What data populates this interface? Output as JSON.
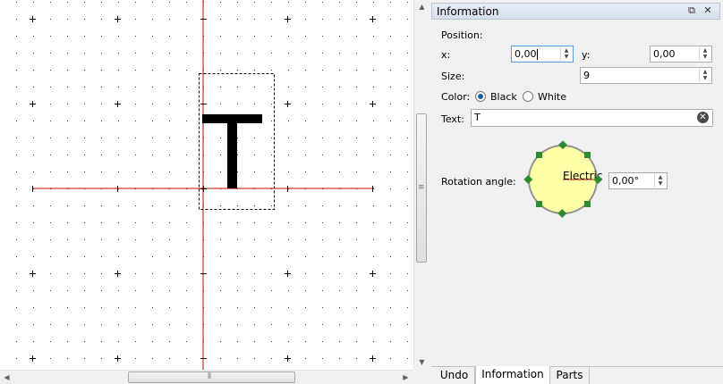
{
  "panel": {
    "title": "Information",
    "header_buttons": [
      "restore-icon",
      "close-icon"
    ]
  },
  "properties": {
    "position_label": "Position:",
    "x_label": "x:",
    "x_value": "0,00",
    "y_label": "y:",
    "y_value": "0,00",
    "size_label": "Size:",
    "size_value": "9",
    "color_label": "Color:",
    "color_options": [
      "Black",
      "White"
    ],
    "color_selected": "Black",
    "text_label": "Text:",
    "text_value": "T",
    "rotation_label": "Rotation angle:",
    "rotation_value": "0,00°",
    "dial_label": "Electric"
  },
  "canvas": {
    "element_text": "T",
    "axis_color": "#cc0000",
    "selection_style": "dashed"
  },
  "tabs": [
    {
      "label": "Undo",
      "active": false
    },
    {
      "label": "Information",
      "active": true
    },
    {
      "label": "Parts",
      "active": false
    }
  ],
  "colors": {
    "dial_fill": "#ffffa8",
    "handle": "#2e8b2e",
    "accent": "#569de5"
  }
}
